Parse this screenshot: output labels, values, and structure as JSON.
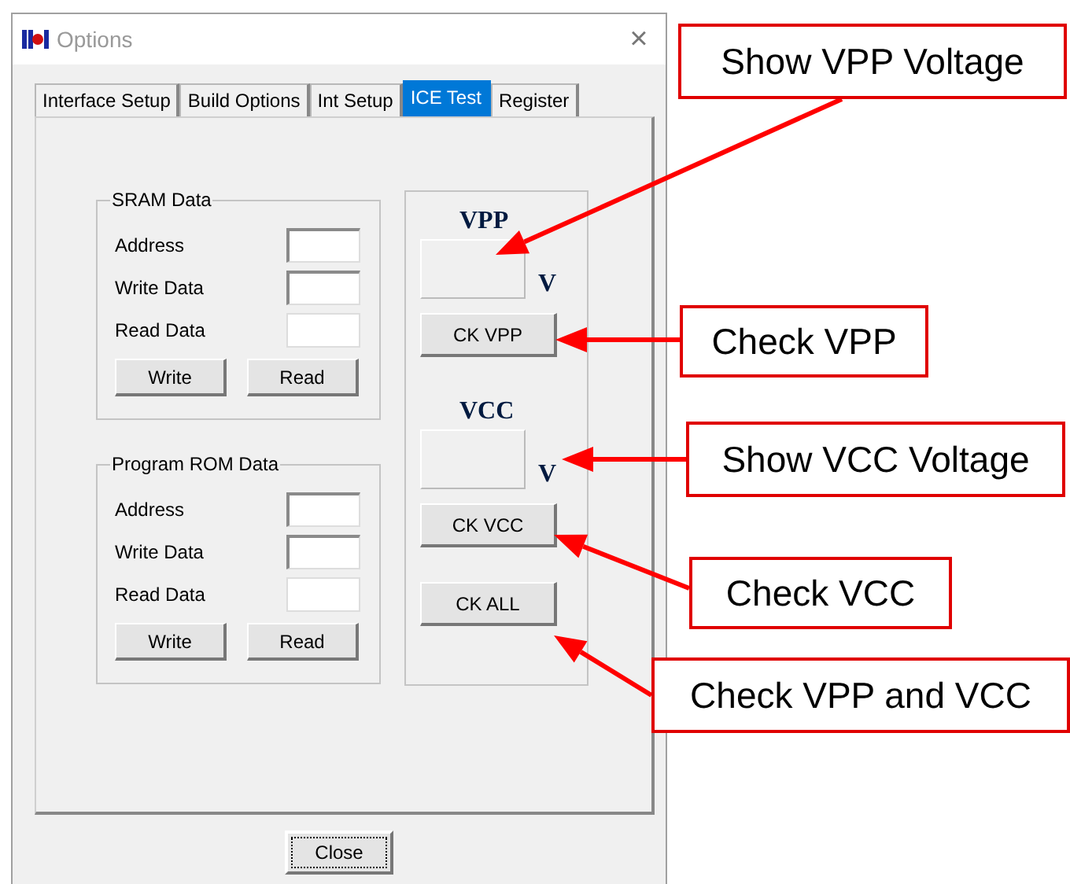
{
  "window": {
    "title": "Options",
    "close": "×"
  },
  "tabs": [
    {
      "label": "Interface Setup",
      "selected": false
    },
    {
      "label": "Build Options",
      "selected": false
    },
    {
      "label": "Int Setup",
      "selected": false
    },
    {
      "label": "ICE Test",
      "selected": true
    },
    {
      "label": "Register",
      "selected": false
    }
  ],
  "groups": [
    {
      "title": "SRAM Data",
      "fields": [
        {
          "label": "Address",
          "read_only": false
        },
        {
          "label": "Write Data",
          "read_only": false
        },
        {
          "label": "Read Data",
          "read_only": true
        }
      ],
      "buttons": [
        "Write",
        "Read"
      ]
    },
    {
      "title": "Program ROM Data",
      "fields": [
        {
          "label": "Address",
          "read_only": false
        },
        {
          "label": "Write Data",
          "read_only": false
        },
        {
          "label": "Read Data",
          "read_only": true
        }
      ],
      "buttons": [
        "Write",
        "Read"
      ]
    }
  ],
  "voltage_panel": {
    "vpp_label": "VPP",
    "vpp_unit": "V",
    "vpp_button": "CK VPP",
    "vcc_label": "VCC",
    "vcc_unit": "V",
    "vcc_button": "CK VCC",
    "all_button": "CK ALL"
  },
  "close_button": "Close",
  "callouts": [
    {
      "text": "Show VPP Voltage"
    },
    {
      "text": "Check VPP"
    },
    {
      "text": "Show VCC Voltage"
    },
    {
      "text": "Check VCC"
    },
    {
      "text": "Check VPP and VCC"
    }
  ]
}
